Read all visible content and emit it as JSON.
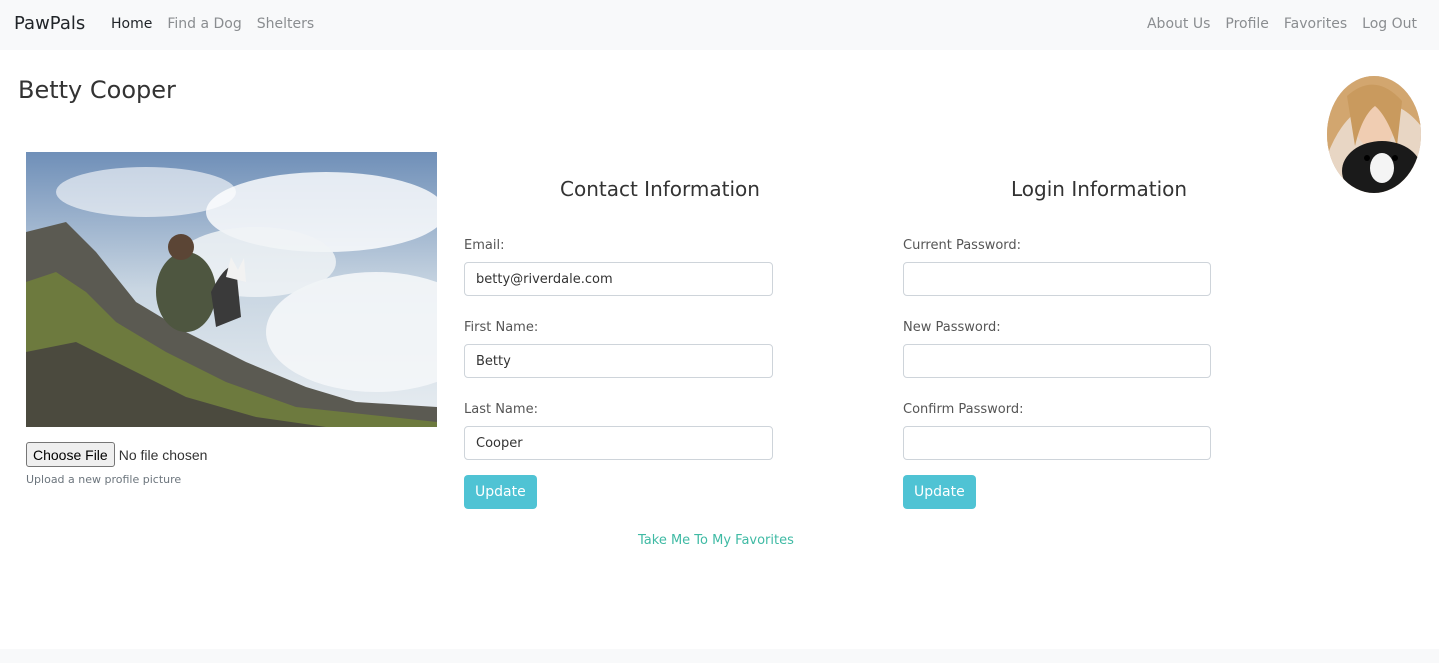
{
  "nav": {
    "brand": "PawPals",
    "left": [
      "Home",
      "Find a Dog",
      "Shelters"
    ],
    "right": [
      "About Us",
      "Profile",
      "Favorites",
      "Log Out"
    ]
  },
  "profile": {
    "name": "Betty Cooper"
  },
  "upload": {
    "button_label": "Choose File",
    "status": "No file chosen",
    "help": "Upload a new profile picture"
  },
  "contact": {
    "title": "Contact Information",
    "email_label": "Email:",
    "email_value": "betty@riverdale.com",
    "first_label": "First Name:",
    "first_value": "Betty",
    "last_label": "Last Name:",
    "last_value": "Cooper",
    "update_label": "Update"
  },
  "login": {
    "title": "Login Information",
    "current_label": "Current Password:",
    "new_label": "New Password:",
    "confirm_label": "Confirm Password:",
    "update_label": "Update"
  },
  "favorites_link": "Take Me To My Favorites",
  "colors": {
    "accent": "#4fc3d4",
    "link": "#3fbaa4",
    "navbar_bg": "#f8f9fa"
  }
}
